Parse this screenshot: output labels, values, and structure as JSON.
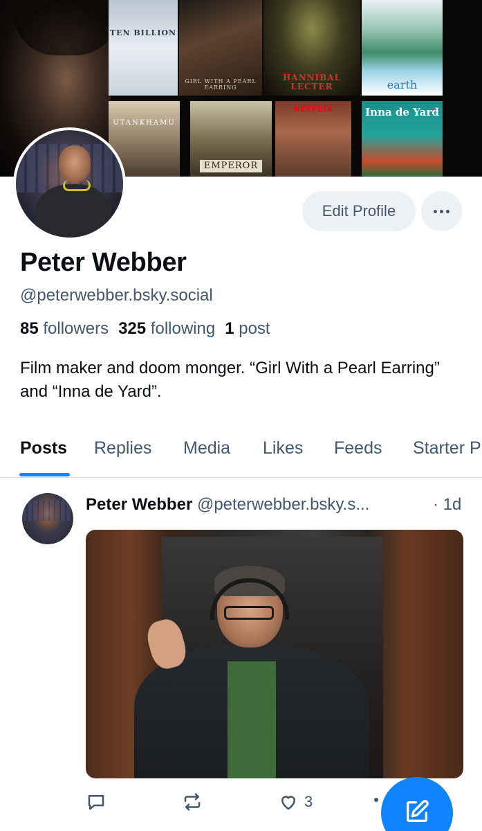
{
  "banner": {
    "posters": [
      {
        "title": "Ten Billion"
      },
      {
        "title": "Girl with a Pearl Earring"
      },
      {
        "title": "Hannibal Lecter"
      },
      {
        "title": "earth"
      },
      {
        "title": "Utankhamu"
      },
      {
        "title": "Emperor"
      },
      {
        "title": "Netflix"
      },
      {
        "title": "Inna de Yard"
      }
    ]
  },
  "profile": {
    "display_name": "Peter Webber",
    "handle": "@peterwebber.bsky.social",
    "followers_count": "85",
    "followers_label": "followers",
    "following_count": "325",
    "following_label": "following",
    "posts_count": "1",
    "posts_label": "post",
    "bio": "Film maker and doom monger. “Girl With a Pearl Earring” and “Inna de Yard”."
  },
  "actions": {
    "edit_profile_label": "Edit Profile",
    "more_icon": "ellipsis-icon"
  },
  "tabs": [
    {
      "label": "Posts",
      "active": true
    },
    {
      "label": "Replies",
      "active": false
    },
    {
      "label": "Media",
      "active": false
    },
    {
      "label": "Likes",
      "active": false
    },
    {
      "label": "Feeds",
      "active": false
    },
    {
      "label": "Starter P",
      "active": false
    }
  ],
  "post": {
    "author": "Peter Webber",
    "handle": "@peterwebber.bsky.s...",
    "time": "· 1d",
    "like_count": "3",
    "icons": [
      "reply-icon",
      "repost-icon",
      "heart-icon",
      "more-icon"
    ]
  },
  "fab": {
    "icon": "compose-icon"
  },
  "colors": {
    "accent": "#1083fe",
    "text_primary": "#0b0f14",
    "text_secondary": "#42576c",
    "button_bg": "#eef1f4"
  }
}
